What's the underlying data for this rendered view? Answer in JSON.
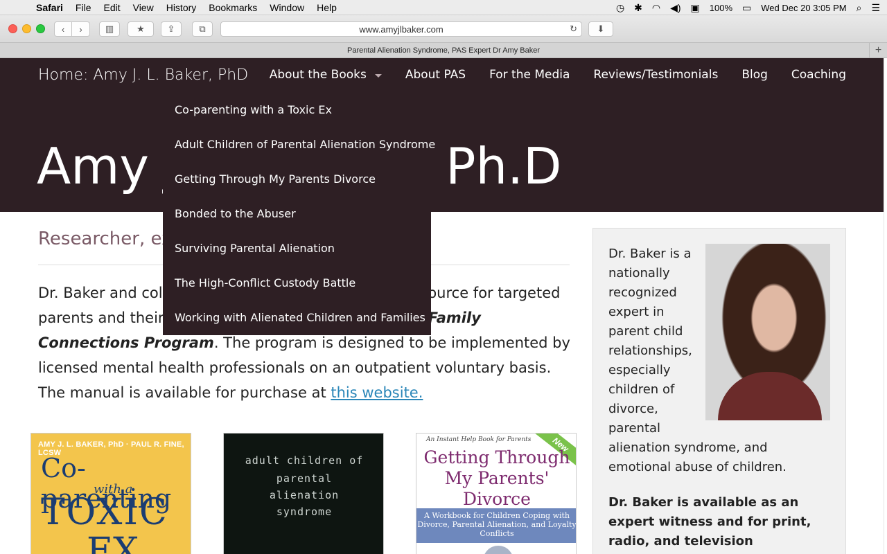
{
  "menubar": {
    "app": "Safari",
    "items": [
      "File",
      "Edit",
      "View",
      "History",
      "Bookmarks",
      "Window",
      "Help"
    ],
    "battery": "100%",
    "datetime": "Wed Dec 20  3:05 PM"
  },
  "toolbar": {
    "url": "www.amyjlbaker.com"
  },
  "tab": {
    "title": "Parental Alienation Syndrome, PAS Expert Dr Amy Baker"
  },
  "site": {
    "home": "Home:   Amy J. L. Baker, PhD",
    "nav": [
      "About the Books",
      "About PAS",
      "For the Media",
      "Reviews/Testimonials",
      "Blog",
      "Coaching"
    ],
    "hero_title": "Amy J. L. Baker, Ph.D",
    "dropdown": [
      "Co-parenting with a Toxic Ex",
      "Adult Children of Parental Alienation Syndrome",
      "Getting Through My Parents Divorce",
      "Bonded to the Abuser",
      "Surviving Parental Alienation",
      "The High-Conflict Custody Battle",
      "Working with Alienated Children and Families"
    ],
    "tagline": "Researcher, expert in parental alienation",
    "intro_before": "Dr. Baker and colleagues have developed a group resource for targeted parents and their adult children called the ",
    "intro_em": "Breaking Family Connections Program",
    "intro_after": ". The program is designed to be implemented by licensed mental health professionals on an outpatient voluntary basis. The manual is available for purchase at ",
    "intro_link": "this website."
  },
  "books": {
    "b1": {
      "authors": "AMY J. L. BAKER, PhD · PAUL R. FINE, LCSW",
      "line1": "Co-parenting",
      "line2": "with a",
      "line3": "TOXIC",
      "line4": "EX"
    },
    "b2": {
      "line1": "adult children of",
      "line2": "parental",
      "line3": "alienation",
      "line4": "syndrome"
    },
    "b3": {
      "small": "An Instant Help Book for Parents",
      "ribbon": "New",
      "title": "Getting Through My Parents' Divorce",
      "subtitle": "A Workbook for Children Coping with Divorce, Parental Alienation, and Loyalty Conflicts"
    }
  },
  "sidebar": {
    "bio_wrap": [
      "Dr. Baker is a",
      "nationally",
      "recognized",
      "expert in",
      "parent child",
      "relationships,",
      "especially",
      "children of",
      "divorce,",
      "parental"
    ],
    "bio_rest": "alienation syndrome, and emotional abuse of children.",
    "availability": "Dr. Baker is available as an expert witness and for print, radio, and television interviews."
  },
  "colors": {
    "header_bg": "#2e1f24",
    "tagline": "#7a5a66",
    "link": "#2a86b8"
  }
}
